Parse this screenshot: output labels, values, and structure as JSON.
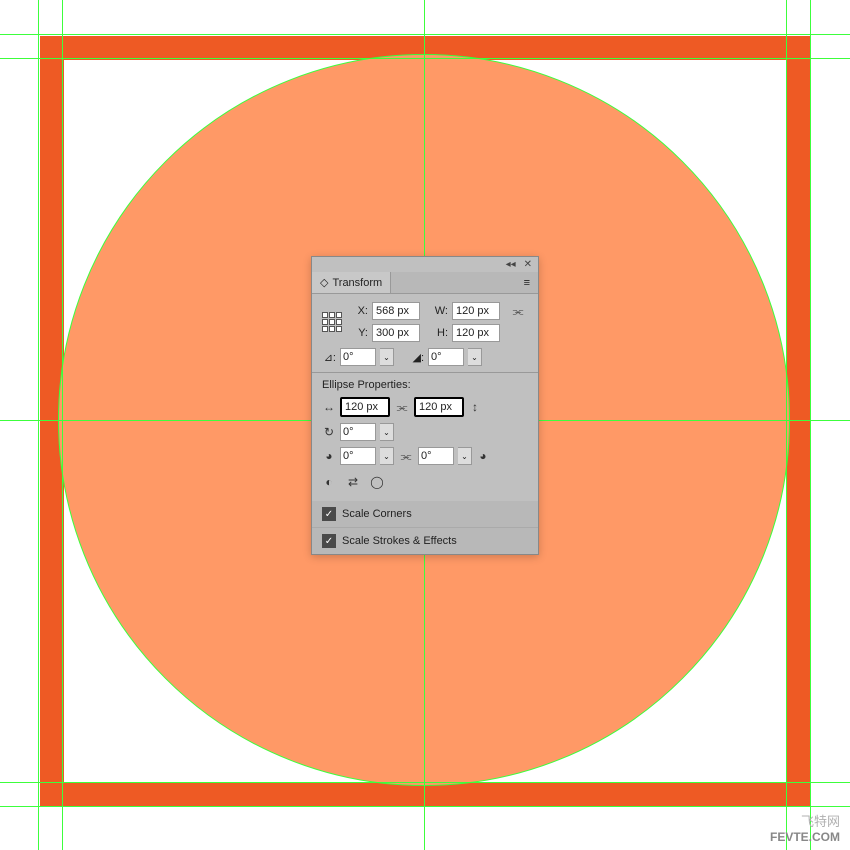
{
  "canvas": {
    "frame_color": "#ee5a24",
    "circle_color": "#ff9966",
    "guide_color": "#3cff3c",
    "guides_h": [
      34,
      58,
      420,
      782,
      806
    ],
    "guides_v": [
      38,
      62,
      424,
      786,
      810
    ]
  },
  "panel": {
    "title": "Transform",
    "x_label": "X:",
    "y_label": "Y:",
    "w_label": "W:",
    "h_label": "H:",
    "x": "568 px",
    "y": "300 px",
    "w": "120 px",
    "h": "120 px",
    "rotate_label": "⊿:",
    "rotate": "0°",
    "shear_label": "◢:",
    "shear": "0°",
    "ellipse_section": "Ellipse Properties:",
    "ellipse_w": "120 px",
    "ellipse_h": "120 px",
    "pie_angle": "0°",
    "start_angle": "0°",
    "end_angle": "0°",
    "scale_corners": "Scale Corners",
    "scale_strokes": "Scale Strokes & Effects"
  },
  "watermark": {
    "line1": "飞特网",
    "line2": "FEVTE.COM"
  }
}
